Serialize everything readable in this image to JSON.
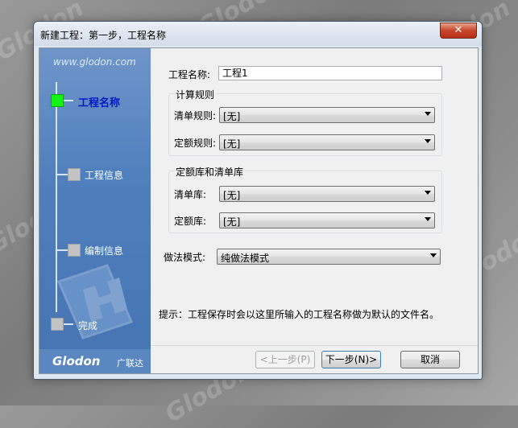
{
  "window": {
    "title": "新建工程：第一步，工程名称",
    "close_icon": "close-icon"
  },
  "sidebar": {
    "url": "www.glodon.com",
    "steps": [
      {
        "label": "工程名称",
        "active": true
      },
      {
        "label": "工程信息",
        "active": false
      },
      {
        "label": "编制信息",
        "active": false
      },
      {
        "label": "完成",
        "active": false
      }
    ],
    "brand": "Glodon",
    "brand_cn": "广联达"
  },
  "form": {
    "project_name_label": "工程名称:",
    "project_name_value": "工程1",
    "calc_rules_title": "计算规则",
    "list_rule_label": "清单规则:",
    "list_rule_value": "[无]",
    "quota_rule_label": "定额规则:",
    "quota_rule_value": "[无]",
    "library_title": "定额库和清单库",
    "list_lib_label": "清单库:",
    "list_lib_value": "[无]",
    "quota_lib_label": "定额库:",
    "quota_lib_value": "[无]",
    "method_label": "做法模式:",
    "method_value": "纯做法模式",
    "hint": "提示：工程保存时会以这里所输入的工程名称做为默认的文件名。"
  },
  "buttons": {
    "prev": "<上一步(P)",
    "next": "下一步(N)>",
    "cancel": "取消"
  }
}
